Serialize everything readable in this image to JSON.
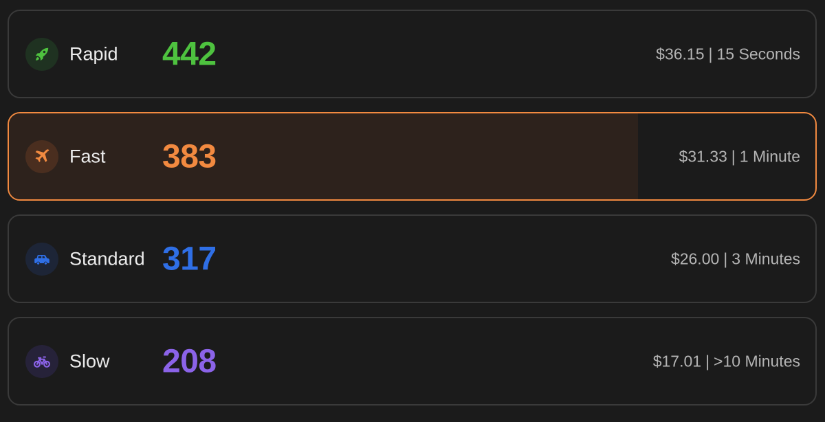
{
  "options": [
    {
      "label": "Rapid",
      "gwei": "442",
      "price": "$36.15",
      "separator": "|",
      "time": "15 Seconds",
      "icon": "rocket-icon",
      "color": "#4ec23f",
      "icon_bg": "#1f3221",
      "selected": false
    },
    {
      "label": "Fast",
      "gwei": "383",
      "price": "$31.33",
      "separator": "|",
      "time": "1 Minute",
      "icon": "airplane-icon",
      "color": "#f28a40",
      "icon_bg": "#4a2e1f",
      "selected": true,
      "fill_fraction": 0.78
    },
    {
      "label": "Standard",
      "gwei": "317",
      "price": "$26.00",
      "separator": "|",
      "time": "3 Minutes",
      "icon": "car-icon",
      "color": "#2f6fe6",
      "icon_bg": "#1d2537",
      "selected": false
    },
    {
      "label": "Slow",
      "gwei": "208",
      "price": "$17.01",
      "separator": "|",
      "time": ">10 Minutes",
      "icon": "bicycle-icon",
      "color": "#8b63e8",
      "icon_bg": "#262239",
      "selected": false
    }
  ]
}
